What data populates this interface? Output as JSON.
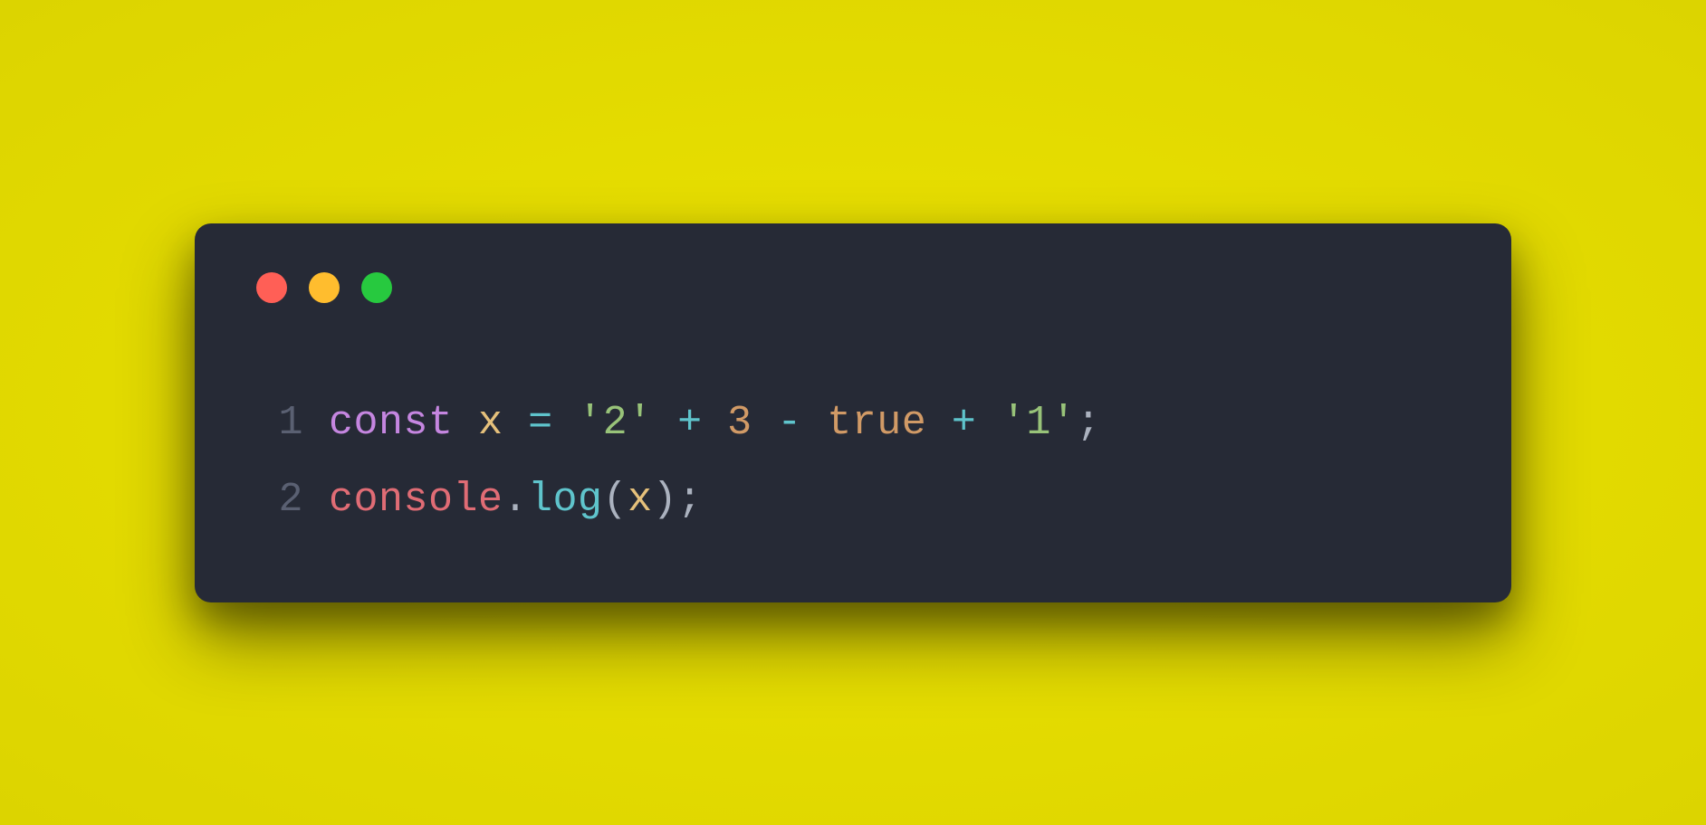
{
  "window": {
    "traffic_lights": [
      "close",
      "minimize",
      "maximize"
    ]
  },
  "code": {
    "lines": [
      {
        "number": "1",
        "tokens": [
          {
            "text": "const",
            "class": "t-keyword"
          },
          {
            "text": " ",
            "class": "t-punct"
          },
          {
            "text": "x",
            "class": "t-var"
          },
          {
            "text": " ",
            "class": "t-punct"
          },
          {
            "text": "=",
            "class": "t-op"
          },
          {
            "text": " ",
            "class": "t-punct"
          },
          {
            "text": "'2'",
            "class": "t-string"
          },
          {
            "text": " ",
            "class": "t-punct"
          },
          {
            "text": "+",
            "class": "t-op"
          },
          {
            "text": " ",
            "class": "t-punct"
          },
          {
            "text": "3",
            "class": "t-number"
          },
          {
            "text": " ",
            "class": "t-punct"
          },
          {
            "text": "-",
            "class": "t-op"
          },
          {
            "text": " ",
            "class": "t-punct"
          },
          {
            "text": "true",
            "class": "t-bool"
          },
          {
            "text": " ",
            "class": "t-punct"
          },
          {
            "text": "+",
            "class": "t-op"
          },
          {
            "text": " ",
            "class": "t-punct"
          },
          {
            "text": "'1'",
            "class": "t-string"
          },
          {
            "text": ";",
            "class": "t-punct"
          }
        ]
      },
      {
        "number": "2",
        "tokens": [
          {
            "text": "console",
            "class": "t-obj"
          },
          {
            "text": ".",
            "class": "t-punct"
          },
          {
            "text": "log",
            "class": "t-method"
          },
          {
            "text": "(",
            "class": "t-punct"
          },
          {
            "text": "x",
            "class": "t-var"
          },
          {
            "text": ")",
            "class": "t-punct"
          },
          {
            "text": ";",
            "class": "t-punct"
          }
        ]
      }
    ]
  }
}
